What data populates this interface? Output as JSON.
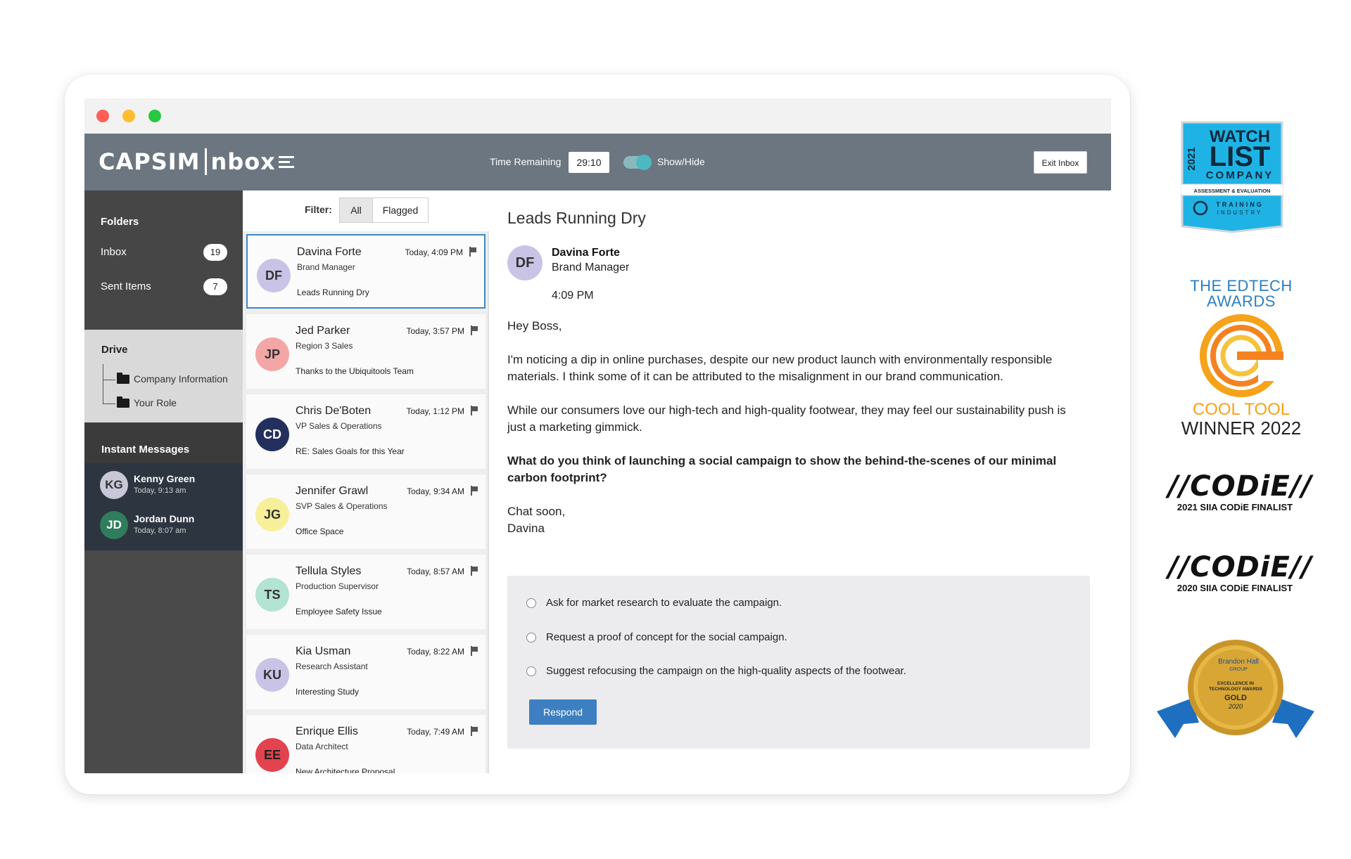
{
  "app": {
    "logo_text": "CAPSIM",
    "logo_text2": "nbox"
  },
  "header": {
    "time_remaining_label": "Time Remaining",
    "time_remaining_value": "29:10",
    "toggle_label": "Show/Hide",
    "toggle_on": true,
    "exit_button": "Exit Inbox"
  },
  "sidebar": {
    "folders_title": "Folders",
    "folders": [
      {
        "label": "Inbox",
        "count": "19"
      },
      {
        "label": "Sent Items",
        "count": "7"
      }
    ],
    "drive_title": "Drive",
    "drive_items": [
      {
        "label": "Company Information"
      },
      {
        "label": "Your Role"
      }
    ],
    "im_title": "Instant Messages",
    "instant_messages": [
      {
        "initials": "KG",
        "name": "Kenny Green",
        "time": "Today, 9:13 am",
        "color": "#c7c7d8",
        "text_color": "#333333"
      },
      {
        "initials": "JD",
        "name": "Jordan Dunn",
        "time": "Today, 8:07 am",
        "color": "#2f7d5c",
        "text_color": "#ffffff"
      }
    ]
  },
  "filter": {
    "label": "Filter:",
    "all": "All",
    "flagged": "Flagged",
    "active": "All"
  },
  "messages": [
    {
      "initials": "DF",
      "name": "Davina Forte",
      "role": "Brand Manager",
      "subject": "Leads Running Dry",
      "time": "Today, 4:09 PM",
      "avatar_color": "#c9c4e6",
      "selected": true
    },
    {
      "initials": "JP",
      "name": "Jed Parker",
      "role": "Region 3 Sales",
      "subject": "Thanks to the Ubiquitools Team",
      "time": "Today, 3:57 PM",
      "avatar_color": "#f3a6a6"
    },
    {
      "initials": "CD",
      "name": "Chris De'Boten",
      "role": "VP Sales & Operations",
      "subject": "RE: Sales Goals for this Year",
      "time": "Today, 1:12 PM",
      "avatar_color": "#23305e"
    },
    {
      "initials": "JG",
      "name": "Jennifer Grawl",
      "role": "SVP Sales & Operations",
      "subject": "Office Space",
      "time": "Today, 9:34 AM",
      "avatar_color": "#f8ef9a"
    },
    {
      "initials": "TS",
      "name": "Tellula Styles",
      "role": "Production Supervisor",
      "subject": "Employee Safety Issue",
      "time": "Today, 8:57 AM",
      "avatar_color": "#b3e3d2"
    },
    {
      "initials": "KU",
      "name": "Kia Usman",
      "role": "Research Assistant",
      "subject": "Interesting Study",
      "time": "Today, 8:22 AM",
      "avatar_color": "#c9c4e6"
    },
    {
      "initials": "EE",
      "name": "Enrique Ellis",
      "role": "Data Architect",
      "subject": "New Architecture Proposal",
      "time": "Today, 7:49 AM",
      "avatar_color": "#e2434f"
    }
  ],
  "reading": {
    "subject": "Leads Running Dry",
    "from_initials": "DF",
    "from_name": "Davina Forte",
    "from_role": "Brand Manager",
    "time": "4:09 PM",
    "greeting": "Hey Boss,",
    "para1": "I'm noticing a dip in online purchases, despite our new product launch with environmentally responsible materials. I think some of it can be attributed to the misalignment in our brand communication.",
    "para2": "While our consumers love our high-tech and high-quality footwear, they may feel our sustainability push is just a marketing gimmick.",
    "question": "What do you think of launching a social campaign to show the behind-the-scenes of our minimal carbon footprint?",
    "signoff1": "Chat soon,",
    "signoff2": "Davina",
    "options": [
      "Ask for market research to evaluate the campaign.",
      "Request a proof of concept for the social campaign.",
      "Suggest refocusing the campaign on the high-quality aspects of the footwear."
    ],
    "respond_button": "Respond"
  },
  "awards": {
    "watchlist": {
      "year": "2021",
      "line1": "WATCH",
      "line2": "LIST",
      "line3": "COMPANY",
      "line4": "ASSESSMENT & EVALUATION",
      "line5": "TRAINING",
      "line6": "INDUSTRY"
    },
    "edtech": {
      "title1": "THE EDTECH",
      "title2": "AWARDS",
      "cool": "COOL TOOL",
      "winner": "WINNER 2022"
    },
    "codie1": {
      "logo": "//CODiE//",
      "sub": "2021 SIIA CODiE FINALIST"
    },
    "codie2": {
      "logo": "//CODiE//",
      "sub": "2020 SIIA CODiE FINALIST"
    },
    "brandon_hall": {
      "line1": "Brandon Hall",
      "line2": "GROUP",
      "line3": "EXCELLENCE IN",
      "line4": "TECHNOLOGY AWARDS",
      "line5": "GOLD",
      "line6": "2020"
    }
  }
}
